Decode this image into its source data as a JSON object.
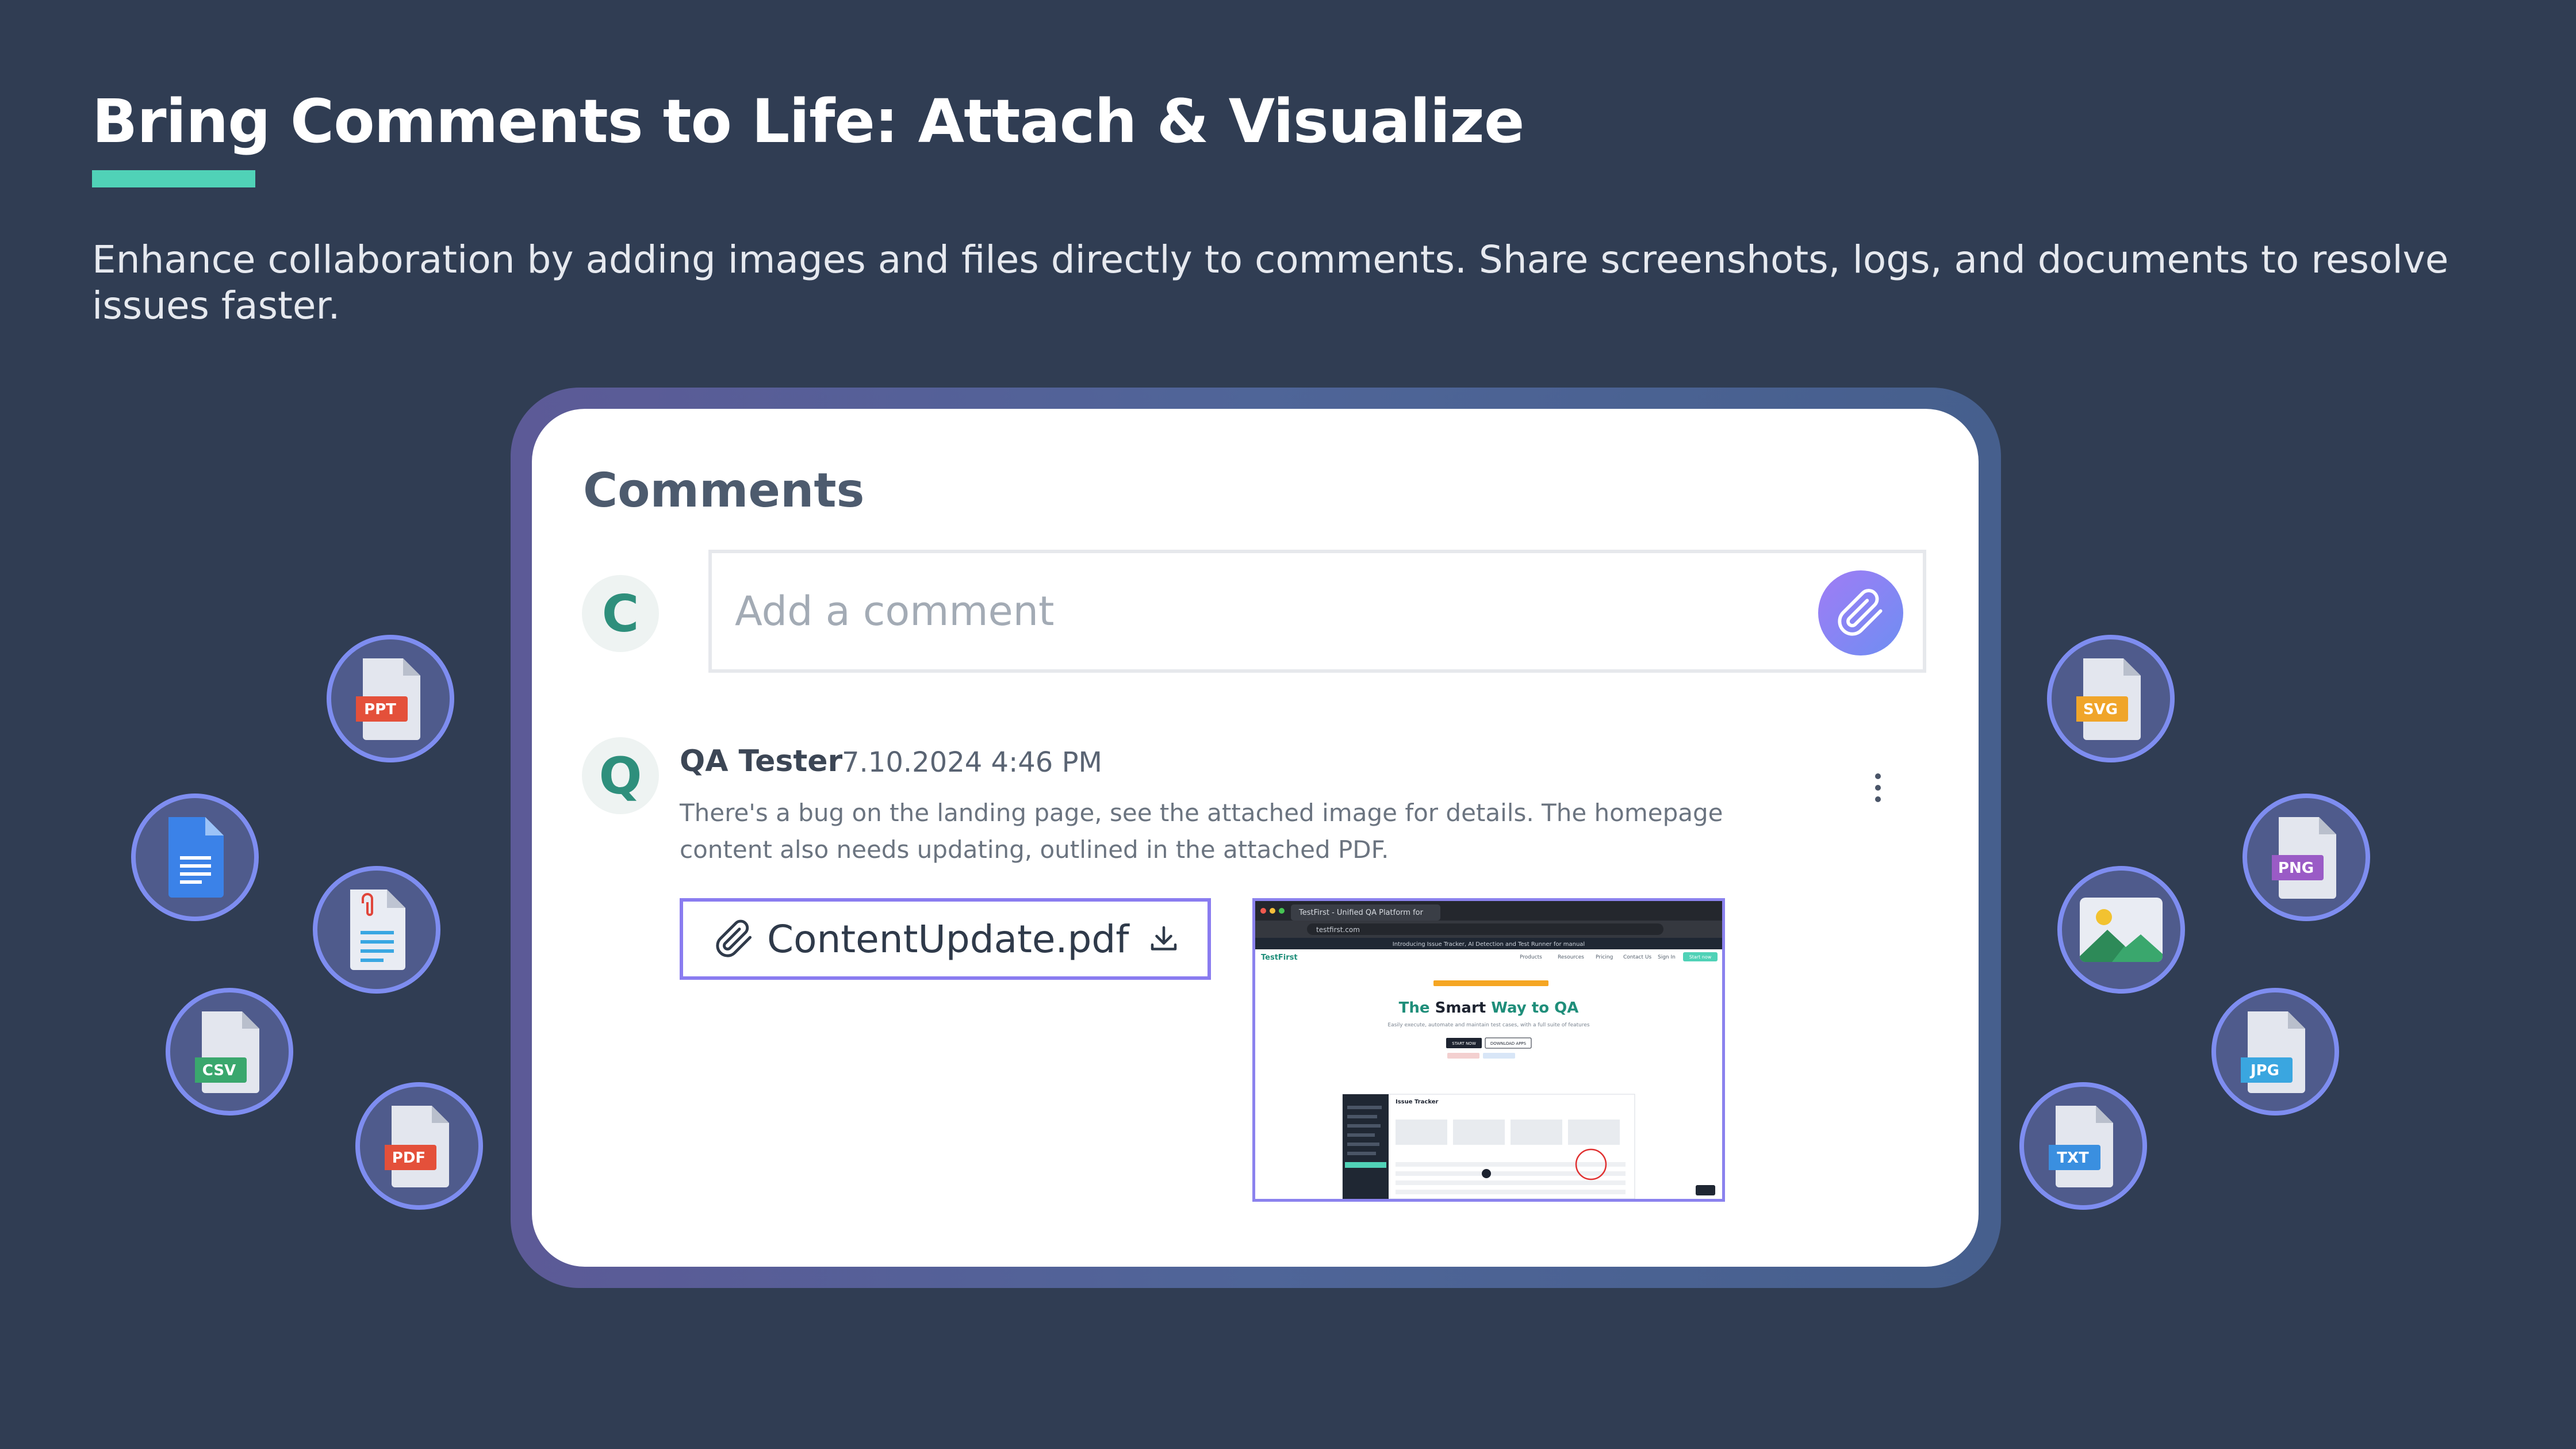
{
  "hero": {
    "headline": "Bring Comments to Life: Attach & Visualize",
    "subheading": "Enhance collaboration by adding images and files directly to comments. Share screenshots, logs, and documents to resolve issues faster."
  },
  "comments_panel": {
    "title": "Comments",
    "current_user_initial": "C",
    "input_placeholder": "Add a comment",
    "comment": {
      "author_initial": "Q",
      "author_name": "QA Tester",
      "timestamp": "7.10.2024 4:46 PM",
      "body": "There's a bug on the landing page, see the attached image for details. The homepage content also needs updating, outlined in the attached PDF.",
      "attachment_file": "ContentUpdate.pdf"
    }
  },
  "screenshot": {
    "tab_title": "TestFirst - Unified QA Platform for",
    "url": "testfirst.com",
    "banner": "Introducing Issue Tracker, AI Detection and Test Runner for manual",
    "logo": "TestFirst",
    "nav": [
      "Products",
      "Resources",
      "Pricing",
      "Contact Us",
      "Sign In"
    ],
    "nav_cta": "Start now",
    "hero_prefix": "The ",
    "hero_bold": "Smart",
    "hero_accent": " Way to QA",
    "tagline": "Easily execute, automate and maintain test cases, with a full suite of features",
    "primary_cta": "START NOW",
    "secondary_cta": "DOWNLOAD APPS",
    "panel_title": "Issue Tracker"
  },
  "file_types_left": [
    "PPT",
    "DOC",
    "NOTE",
    "CSV",
    "PDF"
  ],
  "file_types_right": [
    "SVG",
    "PNG",
    "IMAGE",
    "JPG",
    "TXT"
  ],
  "colors": {
    "background": "#303d53",
    "accent_teal": "#50d2b7",
    "attach_gradient_start": "#a07cf5",
    "attach_gradient_end": "#6e8ef2"
  }
}
